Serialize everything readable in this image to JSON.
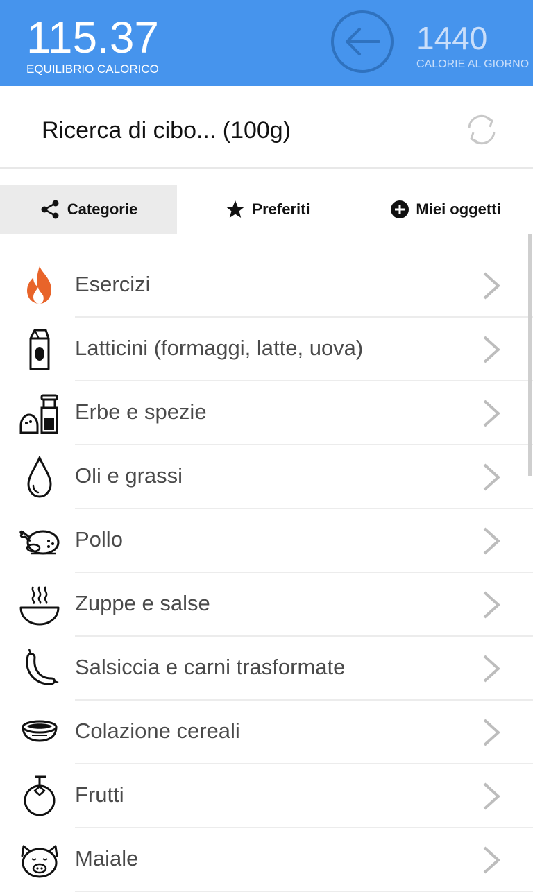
{
  "header": {
    "balance_value": "115.37",
    "balance_label": "EQUILIBRIO CALORICO",
    "calories_value": "1440",
    "calories_label": "CALORIE AL GIORNO",
    "back_icon": "arrow-left-circle-icon",
    "color": "#4694ed"
  },
  "search": {
    "text": "Ricerca di cibo... (100g)",
    "refresh_icon": "refresh-icon"
  },
  "tabs": [
    {
      "label": "Categorie",
      "icon": "share-icon",
      "active": true
    },
    {
      "label": "Preferiti",
      "icon": "star-icon",
      "active": false
    },
    {
      "label": "Miei oggetti",
      "icon": "plus-circle-icon",
      "active": false
    }
  ],
  "categories": [
    {
      "label": "Esercizi",
      "icon": "flame-icon"
    },
    {
      "label": "Latticini (formaggi, latte, uova)",
      "icon": "milk-carton-icon"
    },
    {
      "label": "Erbe e spezie",
      "icon": "spice-grinder-icon"
    },
    {
      "label": "Oli e grassi",
      "icon": "oil-drop-icon"
    },
    {
      "label": "Pollo",
      "icon": "roast-chicken-icon"
    },
    {
      "label": "Zuppe e salse",
      "icon": "soup-bowl-icon"
    },
    {
      "label": "Salsiccia e carni trasformate",
      "icon": "sausage-icon"
    },
    {
      "label": "Colazione cereali",
      "icon": "cereal-bowl-icon"
    },
    {
      "label": "Frutti",
      "icon": "fruit-icon"
    },
    {
      "label": "Maiale",
      "icon": "pig-icon"
    }
  ]
}
